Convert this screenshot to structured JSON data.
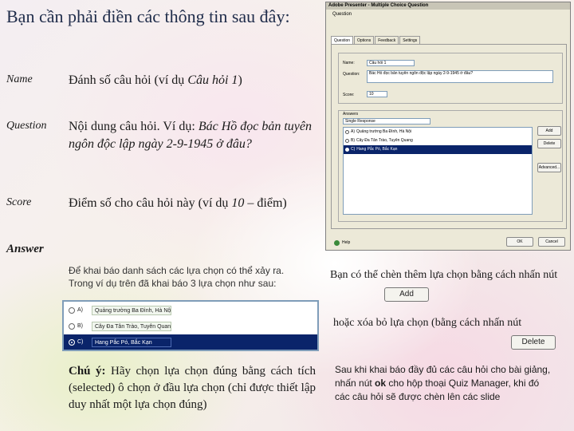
{
  "heading": "Bạn cần phải điền các thông tin sau đây:",
  "fields": [
    {
      "label": "Name",
      "text": "Đánh số câu hỏi (ví dụ ",
      "italic": "Câu hỏi 1",
      "tail": ")"
    },
    {
      "label": "Question",
      "text": "Nội dung câu hỏi. Ví dụ: ",
      "italic": "Bác Hồ đọc bản tuyên ngôn độc lập ngày 2-9-1945 ở đâu?",
      "tail": ""
    },
    {
      "label": "Score",
      "text": "Điểm số cho câu hỏi này (ví dụ ",
      "italic": "10",
      "tail": " – điểm)"
    }
  ],
  "answer_heading": "Answer",
  "answer_desc": "Để khai báo danh sách các lựa chọn có thể xảy ra. Trong ví dụ trên đã khai báo 3 lựa chọn như sau:",
  "answers": [
    {
      "letter": "A)",
      "text": "Quảng trường Ba Đình, Hà Nội",
      "selected": false
    },
    {
      "letter": "B)",
      "text": "Cây Đa Tân Trào, Tuyên Quang",
      "selected": false
    },
    {
      "letter": "C)",
      "text": "Hang Pắc Pó, Bắc Kạn",
      "selected": true
    }
  ],
  "note_bold": "Chú ý:",
  "note_text": " Hãy chọn lựa chọn đúng bằng cách tích (selected) ô chọn ở đầu lựa chọn (chỉ được thiết lập duy nhất một lựa chọn đúng)",
  "right": {
    "add_text": "Bạn có thể chèn thêm lựa chọn bằng cách nhấn nút",
    "add_button": "Add",
    "delete_text": "hoặc xóa bỏ lựa chọn (bằng cách nhấn nút",
    "delete_button": "Delete",
    "final_pre": "Sau khi khai báo đầy đủ các câu hỏi cho bài giảng, nhấn nút ",
    "final_ok": "ok",
    "final_post": " cho hộp thoại Quiz Manager, khi đó các câu hỏi sẽ được chèn lên các slide"
  },
  "dialog": {
    "title": "Adobe Presenter - Multiple Choice Question",
    "subtitle": "Question",
    "tabs": [
      "Question",
      "Options",
      "Feedback",
      "Settings"
    ],
    "name_label": "Name:",
    "name_value": "Câu hỏi 1",
    "question_label": "Question:",
    "question_value": "Bác Hồ đọc bản tuyên ngôn độc lập ngày 2-9-1945 ở đâu?",
    "score_label": "Score:",
    "score_value": "10",
    "answers_label": "Answers",
    "type_value": "Single Response",
    "add": "Add",
    "delete": "Delete",
    "advanced": "Advanced...",
    "ok": "OK",
    "cancel": "Cancel",
    "help": "Help"
  },
  "colors": {
    "selection": "#0a246a",
    "dialog_bg": "#ece9d8",
    "title": "#1f2c4a"
  }
}
